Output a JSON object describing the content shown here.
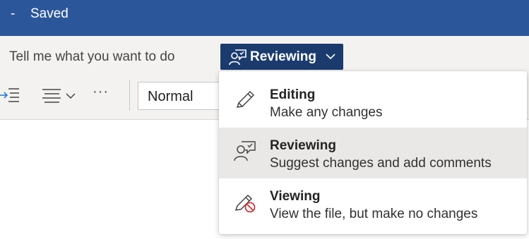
{
  "titlebar": {
    "separator": "-",
    "status": "Saved"
  },
  "tell_me": {
    "text": "Tell me what you want to do"
  },
  "mode_button": {
    "label": "Reviewing",
    "icon": "reviewer-icon"
  },
  "ribbon": {
    "style_value": "Normal",
    "more_label": "···"
  },
  "mode_menu": {
    "items": [
      {
        "title": "Editing",
        "description": "Make any changes",
        "icon": "pencil-icon",
        "selected": false
      },
      {
        "title": "Reviewing",
        "description": "Suggest changes and add comments",
        "icon": "reviewer-icon",
        "selected": true
      },
      {
        "title": "Viewing",
        "description": "View the file, but make no changes",
        "icon": "pencil-prohibited-icon",
        "selected": false
      }
    ]
  },
  "colors": {
    "title_bar": "#2b579a",
    "mode_button": "#1b3b6f",
    "ribbon": "#f3f2f1",
    "selected_item": "#e9e8e7",
    "accent": "#2b7cd3",
    "prohibited": "#d13438"
  }
}
